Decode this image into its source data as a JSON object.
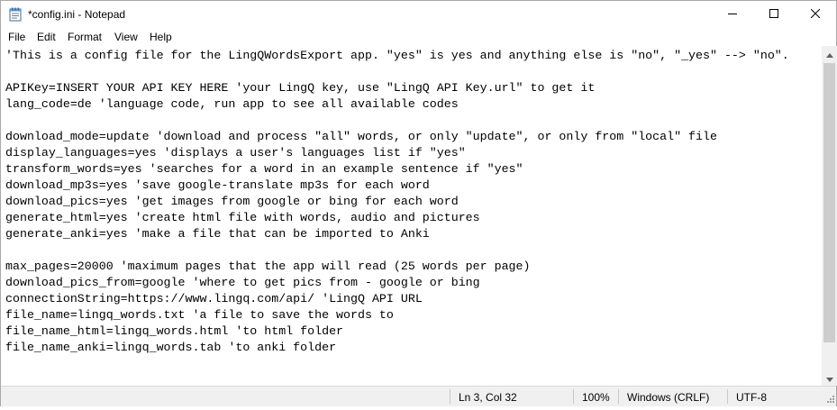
{
  "window": {
    "title": "*config.ini - Notepad",
    "app_icon": "notepad-icon"
  },
  "menu": {
    "items": [
      "File",
      "Edit",
      "Format",
      "View",
      "Help"
    ]
  },
  "editor": {
    "lines": [
      "'This is a config file for the LingQWordsExport app. \"yes\" is yes and anything else is \"no\", \"_yes\" --> \"no\".",
      "",
      "APIKey=INSERT YOUR API KEY HERE 'your LingQ key, use \"LingQ API Key.url\" to get it",
      "lang_code=de 'language code, run app to see all available codes",
      "",
      "download_mode=update 'download and process \"all\" words, or only \"update\", or only from \"local\" file",
      "display_languages=yes 'displays a user's languages list if \"yes\"",
      "transform_words=yes 'searches for a word in an example sentence if \"yes\"",
      "download_mp3s=yes 'save google-translate mp3s for each word",
      "download_pics=yes 'get images from google or bing for each word",
      "generate_html=yes 'create html file with words, audio and pictures",
      "generate_anki=yes 'make a file that can be imported to Anki",
      "",
      "max_pages=20000 'maximum pages that the app will read (25 words per page)",
      "download_pics_from=google 'where to get pics from - google or bing",
      "connectionString=https://www.lingq.com/api/ 'LingQ API URL",
      "file_name=lingq_words.txt 'a file to save the words to",
      "file_name_html=lingq_words.html 'to html folder",
      "file_name_anki=lingq_words.tab 'to anki folder"
    ]
  },
  "statusbar": {
    "position": "Ln 3, Col 32",
    "zoom": "100%",
    "line_ending": "Windows (CRLF)",
    "encoding": "UTF-8"
  }
}
